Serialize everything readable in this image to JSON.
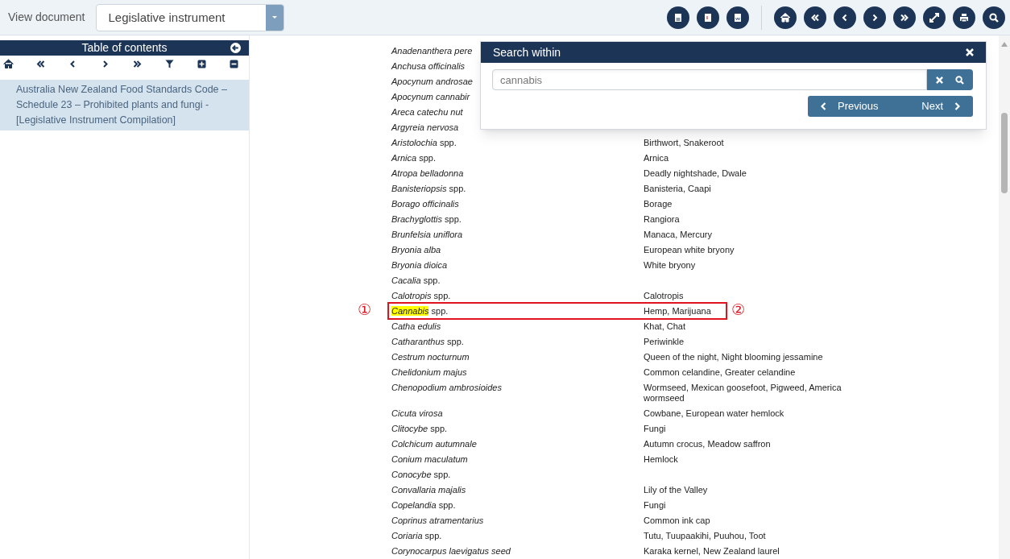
{
  "top_bar": {
    "label": "View document",
    "select_value": "Legislative instrument"
  },
  "toc": {
    "title": "Table of contents",
    "items": [
      {
        "text": "Australia New Zealand Food Standards Code – Schedule 23 – Prohibited plants and fungi - [Legislative Instrument Compilation]",
        "selected": true
      }
    ]
  },
  "table": {
    "rows": [
      {
        "genus": "Anadenanthera pere"
      },
      {
        "genus": "Anchusa officinalis"
      },
      {
        "genus": "Apocynum androsae"
      },
      {
        "genus": "Apocynum cannabir"
      },
      {
        "genus": "Areca catechu nut"
      },
      {
        "genus": "Argyreia nervosa"
      },
      {
        "genus": "Aristolochia",
        "rest": "spp.",
        "common": "Birthwort, Snakeroot"
      },
      {
        "genus": "Arnica",
        "rest": "spp.",
        "common": "Arnica"
      },
      {
        "genus": "Atropa belladonna",
        "common": "Deadly nightshade, Dwale"
      },
      {
        "genus": "Banisteriopsis",
        "rest": "spp.",
        "common": "Banisteria, Caapi"
      },
      {
        "genus": "Borago officinalis",
        "common": "Borage"
      },
      {
        "genus": "Brachyglottis",
        "rest": "spp.",
        "common": "Rangiora"
      },
      {
        "genus": "Brunfelsia uniflora",
        "common": "Manaca, Mercury"
      },
      {
        "genus": "Bryonia alba",
        "common": "European white bryony"
      },
      {
        "genus": "Bryonia dioica",
        "common": "White bryony"
      },
      {
        "genus": "Cacalia",
        "rest": "spp."
      },
      {
        "genus": "Calotropis",
        "rest": "spp.",
        "common": "Calotropis"
      },
      {
        "genus": "Cannabis",
        "rest": "spp.",
        "common": "Hemp, Marijuana",
        "highlighted": true,
        "callouts": [
          "①",
          "②"
        ]
      },
      {
        "genus": "Catha edulis",
        "common": "Khat, Chat"
      },
      {
        "genus": "Catharanthus",
        "rest": "spp.",
        "common": "Periwinkle"
      },
      {
        "genus": "Cestrum nocturnum",
        "common": "Queen of the night, Night blooming jessamine"
      },
      {
        "genus": "Chelidonium majus",
        "common": "Common celandine, Greater celandine"
      },
      {
        "genus": "Chenopodium ambrosioides",
        "common": "Wormseed, Mexican goosefoot, Pigweed, America wormseed"
      },
      {
        "genus": "Cicuta virosa",
        "common": "Cowbane, European water hemlock"
      },
      {
        "genus": "Clitocybe",
        "rest": "spp.",
        "common": "Fungi"
      },
      {
        "genus": "Colchicum autumnale",
        "common": "Autumn crocus, Meadow saffron"
      },
      {
        "genus": "Conium maculatum",
        "common": "Hemlock"
      },
      {
        "genus": "Conocybe",
        "rest": "spp."
      },
      {
        "genus": "Convallaria majalis",
        "common": "Lily of the Valley"
      },
      {
        "genus": "Copelandia",
        "rest": "spp.",
        "common": "Fungi"
      },
      {
        "genus": "Coprinus atramentarius",
        "common": "Common ink cap"
      },
      {
        "genus": "Coriaria",
        "rest": "spp.",
        "common": "Tutu, Tuupaakihi, Puuhou, Toot"
      },
      {
        "genus": "Corynocarpus laevigatus seed",
        "common": "Karaka kernel, New Zealand laurel"
      }
    ]
  },
  "search_panel": {
    "title": "Search within",
    "query": "cannabis",
    "previous": "Previous",
    "next": "Next"
  }
}
